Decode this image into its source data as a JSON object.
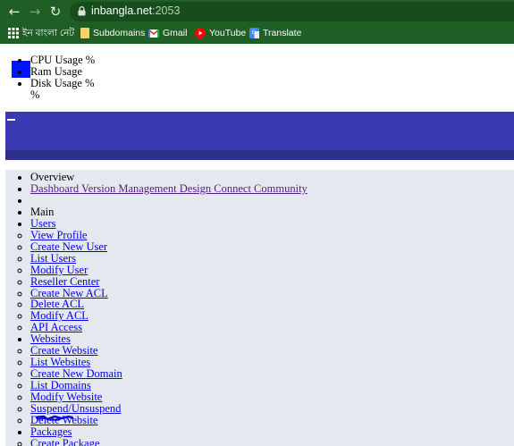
{
  "browser": {
    "url_host": "inbangla.net",
    "url_port": ":2053",
    "bookmarks": [
      {
        "label": "ইন বাংলা নেট",
        "icon": "apps-grid-icon"
      },
      {
        "label": "Subdomains",
        "icon": "folder-icon"
      },
      {
        "label": "Gmail",
        "icon": "gmail-icon"
      },
      {
        "label": "YouTube",
        "icon": "youtube-icon"
      },
      {
        "label": "Translate",
        "icon": "translate-icon"
      }
    ],
    "colors": {
      "chrome": "#1f5e25",
      "urlbar": "#174d1c"
    }
  },
  "usage": {
    "cpu": "CPU Usage %",
    "ram": "Ram Usage",
    "disk": "Disk Usage %",
    "extra": "%"
  },
  "menu": {
    "overview": "Overview",
    "nav_links": "Dashboard Version Management Design Connect Community",
    "main": "Main",
    "users": {
      "label": "Users",
      "items": [
        "View Profile",
        "Create New User",
        "List Users",
        "Modify User",
        "Reseller Center",
        "Create New ACL",
        "Delete ACL",
        "Modify ACL",
        "API Access"
      ]
    },
    "websites": {
      "label": "Websites",
      "items": [
        "Create Website",
        "List Websites",
        "Create New Domain",
        "List Domains",
        "Modify Website",
        "Suspend/Unsuspend",
        "Delete Website"
      ]
    },
    "packages": {
      "label": "Packages",
      "items": [
        "Create Package"
      ]
    }
  },
  "colors": {
    "header": "#3a3ab5",
    "sidebar": "#e6e8ef",
    "link": "#0000ee",
    "accent_square": "#0014ff"
  }
}
